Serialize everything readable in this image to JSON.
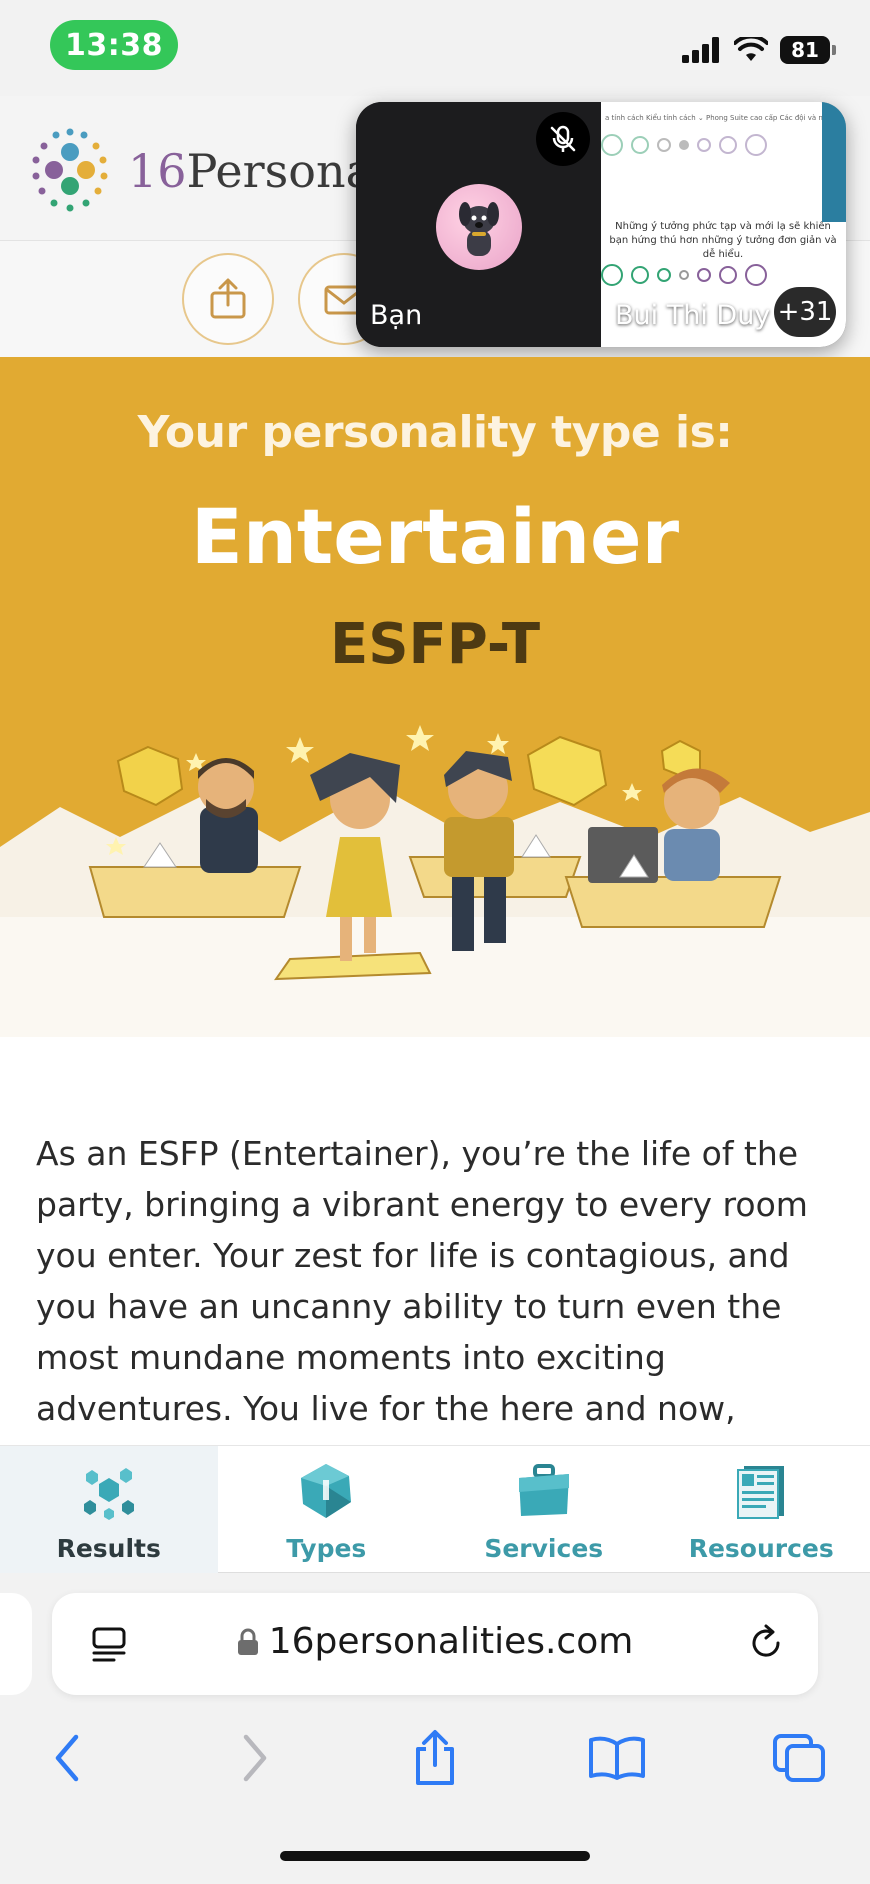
{
  "status_bar": {
    "time": "13:38",
    "battery": "81",
    "icons": [
      "signal-icon",
      "wifi-icon",
      "battery-icon"
    ]
  },
  "header": {
    "logo_number": "16",
    "logo_word": "Personal",
    "actions": [
      "share-icon",
      "mail-icon"
    ]
  },
  "pip": {
    "self_label": "Bạn",
    "remote_label": "Bui Thi Duy",
    "participant_count": "+31",
    "remote_menu": "a tính cách   Kiểu tính cách ⌄   Phong Suite cao cấp   Các đội và người thực hành ⌄",
    "remote_question": "Những ý tưởng phức tạp và mới lạ sẽ khiến bạn hứng thú hơn những ý tưởng đơn giản và dễ hiểu."
  },
  "hero": {
    "subtitle": "Your personality type is:",
    "title": "Entertainer",
    "code": "ESFP-T",
    "bg_color": "#e1aa32"
  },
  "intro": {
    "text": "As an ESFP (Entertainer), you’re the life of the party, bringing a vibrant energy to every room you enter. Your zest for life is contagious, and you have an uncanny ability to turn even the most mundane moments into exciting adventures. You live for the here and now,"
  },
  "tabs": [
    {
      "label": "Results",
      "icon": "results-icon",
      "active": true
    },
    {
      "label": "Types",
      "icon": "types-icon",
      "active": false
    },
    {
      "label": "Services",
      "icon": "services-icon",
      "active": false
    },
    {
      "label": "Resources",
      "icon": "resources-icon",
      "active": false
    }
  ],
  "safari": {
    "url": "16personalities.com",
    "accent": "#2f7bf5"
  }
}
